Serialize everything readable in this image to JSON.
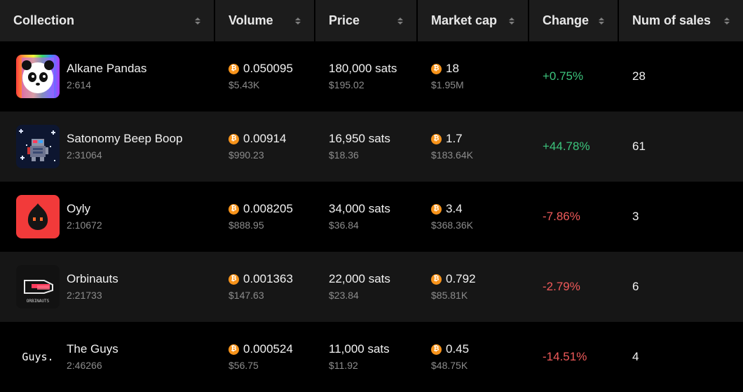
{
  "header": {
    "collection": "Collection",
    "volume": "Volume",
    "price": "Price",
    "market_cap": "Market cap",
    "change": "Change",
    "num_sales": "Num of sales"
  },
  "currency_icon": "bitcoin-icon",
  "colors": {
    "positive": "#3cc47c",
    "negative": "#f05a5a",
    "btc": "#f7931a"
  },
  "rows": [
    {
      "name": "Alkane Pandas",
      "id": "2:614",
      "volume": "0.050095",
      "volume_usd": "$5.43K",
      "price": "180,000 sats",
      "price_usd": "$195.02",
      "mcap": "18",
      "mcap_usd": "$1.95M",
      "change": "+0.75%",
      "sales": "28"
    },
    {
      "name": "Satonomy Beep Boop",
      "id": "2:31064",
      "volume": "0.00914",
      "volume_usd": "$990.23",
      "price": "16,950 sats",
      "price_usd": "$18.36",
      "mcap": "1.7",
      "mcap_usd": "$183.64K",
      "change": "+44.78%",
      "sales": "61"
    },
    {
      "name": "Oyly",
      "id": "2:10672",
      "volume": "0.008205",
      "volume_usd": "$888.95",
      "price": "34,000 sats",
      "price_usd": "$36.84",
      "mcap": "3.4",
      "mcap_usd": "$368.36K",
      "change": "-7.86%",
      "sales": "3"
    },
    {
      "name": "Orbinauts",
      "id": "2:21733",
      "volume": "0.001363",
      "volume_usd": "$147.63",
      "price": "22,000 sats",
      "price_usd": "$23.84",
      "mcap": "0.792",
      "mcap_usd": "$85.81K",
      "change": "-2.79%",
      "sales": "6"
    },
    {
      "name": "The Guys",
      "id": "2:46266",
      "volume": "0.000524",
      "volume_usd": "$56.75",
      "price": "11,000 sats",
      "price_usd": "$11.92",
      "mcap": "0.45",
      "mcap_usd": "$48.75K",
      "change": "-14.51%",
      "sales": "4"
    }
  ],
  "thumb_text": {
    "orbinauts": "ORBINAUTS",
    "the_guys": "Guys."
  }
}
